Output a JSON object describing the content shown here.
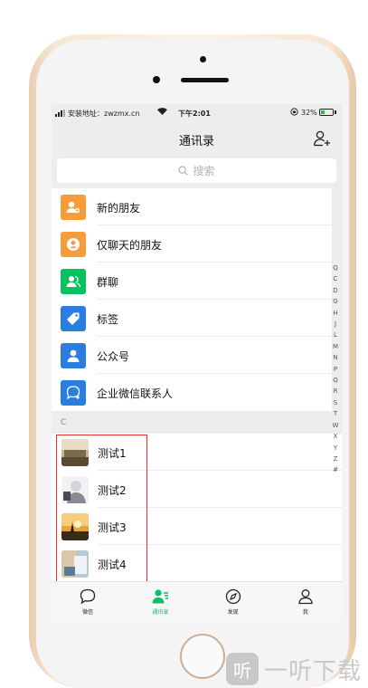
{
  "status_bar": {
    "carrier": "安装地址：zwzmx.cn",
    "time": "下午2:01",
    "battery": "32%",
    "battery_level": 0.32
  },
  "header": {
    "title": "通讯录"
  },
  "search": {
    "placeholder": "搜索"
  },
  "function_items": [
    {
      "label": "新的朋友",
      "icon": "new-friend-icon",
      "color": "#f79c3a"
    },
    {
      "label": "仅聊天的朋友",
      "icon": "chat-only-friend-icon",
      "color": "#f79c3a"
    },
    {
      "label": "群聊",
      "icon": "group-chat-icon",
      "color": "#07c160"
    },
    {
      "label": "标签",
      "icon": "tag-icon",
      "color": "#2a7de1"
    },
    {
      "label": "公众号",
      "icon": "official-account-icon",
      "color": "#2a7de1"
    },
    {
      "label": "企业微信联系人",
      "icon": "wecom-contact-icon",
      "color": "#2a7de1"
    }
  ],
  "section_header": "C",
  "contacts": [
    {
      "name": "测试1"
    },
    {
      "name": "测试2"
    },
    {
      "name": "测试3"
    },
    {
      "name": "测试4"
    }
  ],
  "index_letters": [
    "Q",
    "C",
    "D",
    "G",
    "H",
    "J",
    "L",
    "M",
    "N",
    "P",
    "Q",
    "R",
    "S",
    "T",
    "W",
    "X",
    "Y",
    "Z",
    "#"
  ],
  "tabs": [
    {
      "label": "微信",
      "icon": "chat-bubble-icon",
      "active": false
    },
    {
      "label": "通讯录",
      "icon": "contacts-icon",
      "active": true
    },
    {
      "label": "发现",
      "icon": "compass-icon",
      "active": false
    },
    {
      "label": "我",
      "icon": "person-icon",
      "active": false
    }
  ],
  "watermark": {
    "logo_char": "听",
    "text": "一听下载"
  },
  "colors": {
    "accent": "#07c160",
    "highlight_border": "#e0302f"
  }
}
